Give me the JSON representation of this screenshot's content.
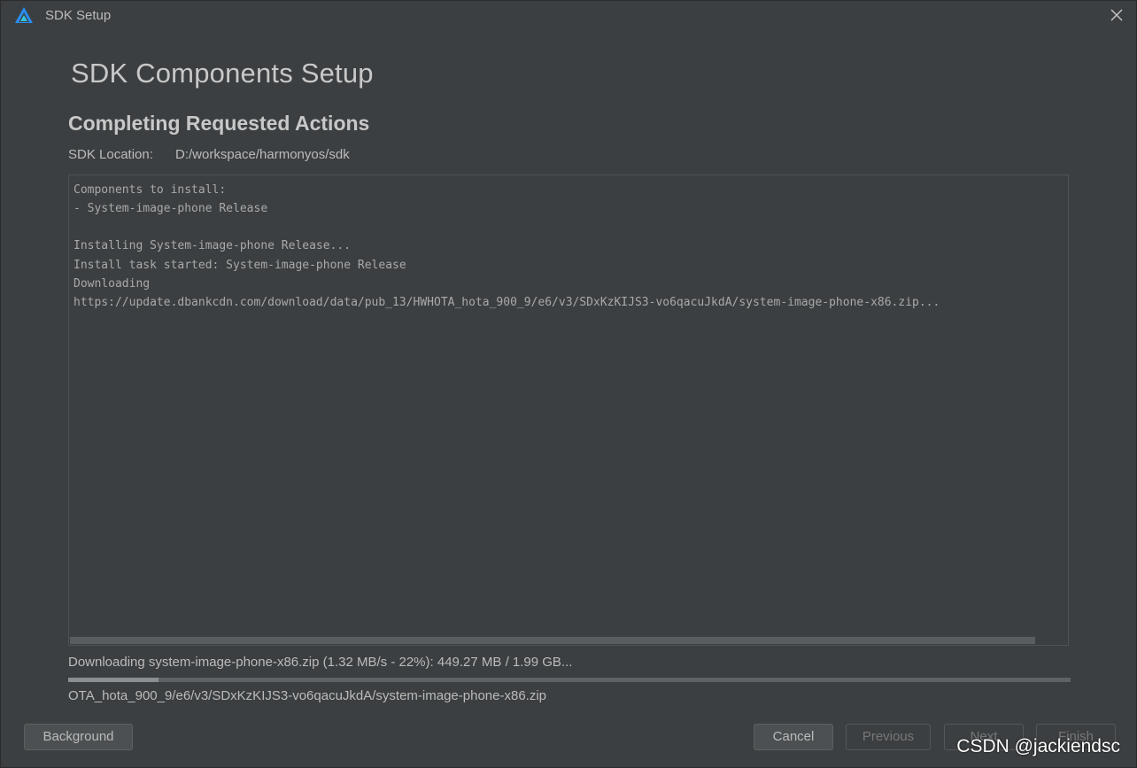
{
  "window": {
    "title": "SDK Setup",
    "app_icon": "harmonyos-deveco-icon",
    "close_icon": "close-icon"
  },
  "page": {
    "title": "SDK Components Setup",
    "section_title": "Completing Requested Actions",
    "sdk_location_label": "SDK Location:",
    "sdk_location_value": "D:/workspace/harmonyos/sdk"
  },
  "console": {
    "lines": [
      "Components to install:",
      "- System-image-phone Release",
      "",
      "Installing System-image-phone Release...",
      "Install task started: System-image-phone Release",
      "Downloading",
      "https://update.dbankcdn.com/download/data/pub_13/HWHOTA_hota_900_9/e6/v3/SDxKzKIJS3-vo6qacuJkdA/system-image-phone-x86.zip..."
    ]
  },
  "progress": {
    "status": "Downloading system-image-phone-x86.zip (1.32 MB/s - 22%): 449.27 MB / 1.99 GB...",
    "fraction": 0.09,
    "file": "OTA_hota_900_9/e6/v3/SDxKzKIJS3-vo6qacuJkdA/system-image-phone-x86.zip"
  },
  "buttons": {
    "background": "Background",
    "cancel": "Cancel",
    "previous": "Previous",
    "next": "Next",
    "finish": "Finish"
  },
  "watermark": "CSDN @jackiendsc",
  "colors": {
    "background": "#3c3f41",
    "text": "#bbbbbb",
    "icon_blue": "#2a8df2",
    "icon_cyan": "#33c3dc"
  }
}
